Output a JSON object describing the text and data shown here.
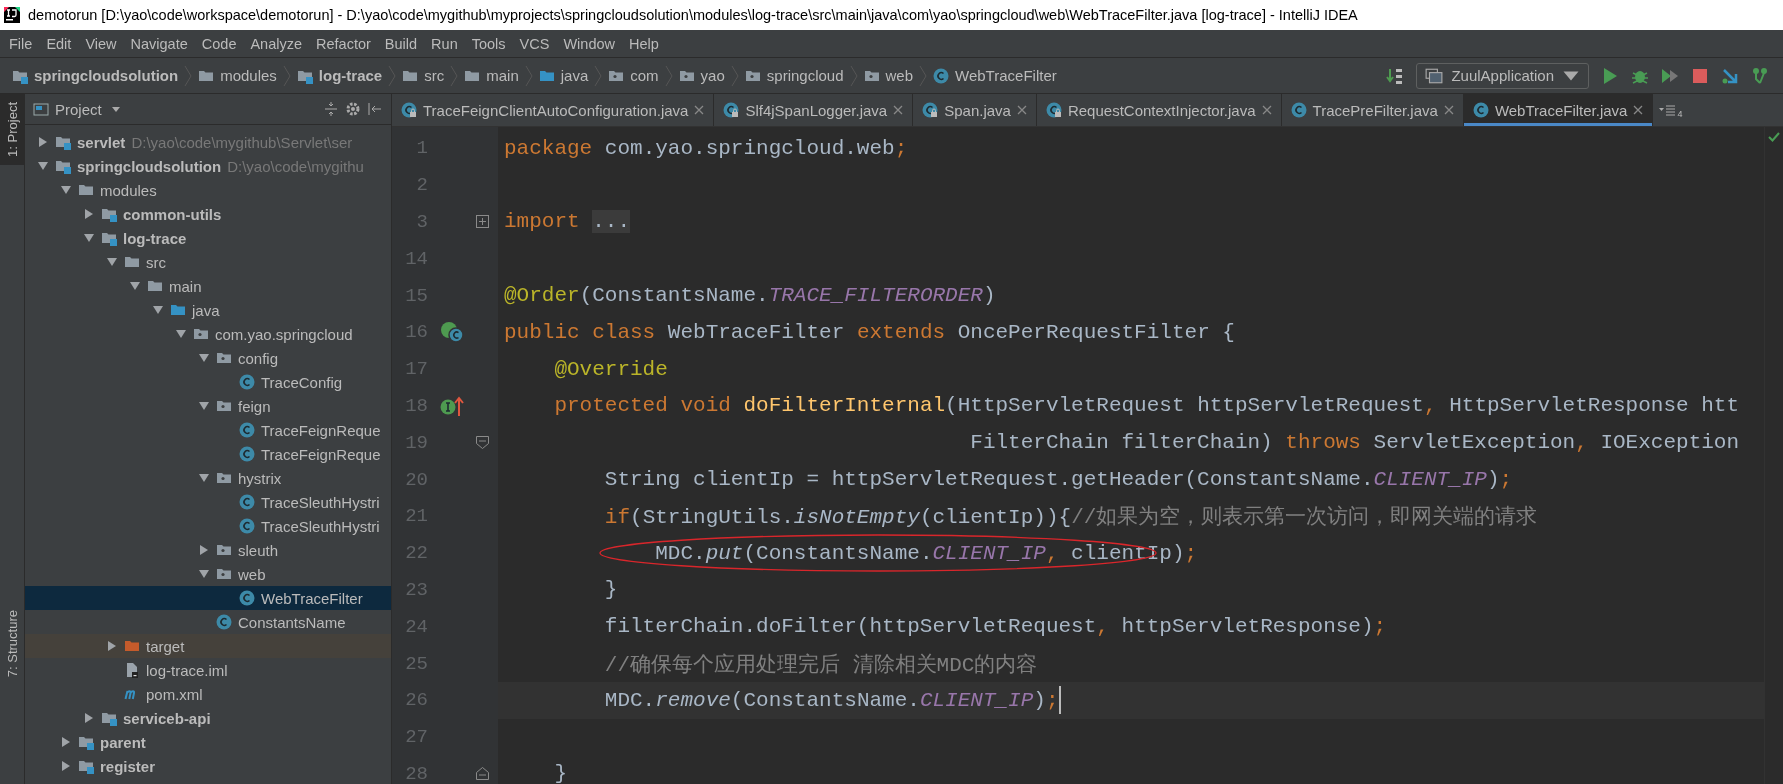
{
  "window": {
    "title": "demotorun [D:\\yao\\code\\workspace\\demotorun] - D:\\yao\\code\\mygithub\\myprojects\\springcloudsolution\\modules\\log-trace\\src\\main\\java\\com\\yao\\springcloud\\web\\WebTraceFilter.java [log-trace] - IntelliJ IDEA"
  },
  "menu": [
    "File",
    "Edit",
    "View",
    "Navigate",
    "Code",
    "Analyze",
    "Refactor",
    "Build",
    "Run",
    "Tools",
    "VCS",
    "Window",
    "Help"
  ],
  "breadcrumbs": [
    {
      "label": "springcloudsolution",
      "kind": "module"
    },
    {
      "label": "modules",
      "kind": "folder"
    },
    {
      "label": "log-trace",
      "kind": "module"
    },
    {
      "label": "src",
      "kind": "folder"
    },
    {
      "label": "main",
      "kind": "folder"
    },
    {
      "label": "java",
      "kind": "source"
    },
    {
      "label": "com",
      "kind": "package"
    },
    {
      "label": "yao",
      "kind": "package"
    },
    {
      "label": "springcloud",
      "kind": "package"
    },
    {
      "label": "web",
      "kind": "package"
    },
    {
      "label": "WebTraceFilter",
      "kind": "class"
    }
  ],
  "run_config": "ZuulApplication",
  "tool_windows": [
    {
      "label": "1: Project",
      "selected": true
    },
    {
      "label": "7: Structure",
      "selected": false
    }
  ],
  "project_panel": {
    "title": "Project",
    "tree": [
      {
        "label": "servlet",
        "hint": "D:\\yao\\code\\mygithub\\Servlet\\ser",
        "kind": "module",
        "expanded": false,
        "selected": false
      },
      {
        "label": "springcloudsolution",
        "hint": "D:\\yao\\code\\mygithu",
        "kind": "module",
        "expanded": true,
        "selected": false,
        "children": [
          {
            "label": "modules",
            "kind": "folder",
            "expanded": true,
            "selected": false,
            "children": [
              {
                "label": "common-utils",
                "kind": "module",
                "expanded": false,
                "selected": false
              },
              {
                "label": "log-trace",
                "kind": "module",
                "expanded": true,
                "selected": false,
                "children": [
                  {
                    "label": "src",
                    "kind": "folder",
                    "expanded": true,
                    "selected": false,
                    "children": [
                      {
                        "label": "main",
                        "kind": "folder",
                        "expanded": true,
                        "selected": false,
                        "children": [
                          {
                            "label": "java",
                            "kind": "source",
                            "expanded": true,
                            "selected": false,
                            "children": [
                              {
                                "label": "com.yao.springcloud",
                                "kind": "package",
                                "expanded": true,
                                "selected": false,
                                "children": [
                                  {
                                    "label": "config",
                                    "kind": "package",
                                    "expanded": true,
                                    "selected": false,
                                    "children": [
                                      {
                                        "label": "TraceConfig",
                                        "kind": "class",
                                        "selected": false
                                      }
                                    ]
                                  },
                                  {
                                    "label": "feign",
                                    "kind": "package",
                                    "expanded": true,
                                    "selected": false,
                                    "children": [
                                      {
                                        "label": "TraceFeignReque",
                                        "kind": "class",
                                        "selected": false
                                      },
                                      {
                                        "label": "TraceFeignReque",
                                        "kind": "class",
                                        "selected": false
                                      }
                                    ]
                                  },
                                  {
                                    "label": "hystrix",
                                    "kind": "package",
                                    "expanded": true,
                                    "selected": false,
                                    "children": [
                                      {
                                        "label": "TraceSleuthHystri",
                                        "kind": "class",
                                        "selected": false
                                      },
                                      {
                                        "label": "TraceSleuthHystri",
                                        "kind": "class",
                                        "selected": false
                                      }
                                    ]
                                  },
                                  {
                                    "label": "sleuth",
                                    "kind": "package",
                                    "expanded": false,
                                    "selected": false
                                  },
                                  {
                                    "label": "web",
                                    "kind": "package",
                                    "expanded": true,
                                    "selected": false,
                                    "children": [
                                      {
                                        "label": "WebTraceFilter",
                                        "kind": "class",
                                        "selected": true
                                      }
                                    ]
                                  },
                                  {
                                    "label": "ConstantsName",
                                    "kind": "class",
                                    "selected": false
                                  }
                                ]
                              }
                            ]
                          }
                        ]
                      }
                    ]
                  },
                  {
                    "label": "target",
                    "kind": "excluded",
                    "expanded": false,
                    "selected": false
                  },
                  {
                    "label": "log-trace.iml",
                    "kind": "iml",
                    "selected": false
                  },
                  {
                    "label": "pom.xml",
                    "kind": "maven",
                    "selected": false
                  }
                ]
              },
              {
                "label": "serviceb-api",
                "kind": "module",
                "expanded": false,
                "selected": false
              }
            ]
          },
          {
            "label": "parent",
            "kind": "module",
            "expanded": false,
            "selected": false
          },
          {
            "label": "register",
            "kind": "module",
            "expanded": false,
            "selected": false
          }
        ]
      }
    ]
  },
  "tabs": [
    {
      "label": "TraceFeignClientAutoConfiguration.java",
      "locked": true,
      "selected": false
    },
    {
      "label": "Slf4jSpanLogger.java",
      "locked": true,
      "selected": false
    },
    {
      "label": "Span.java",
      "locked": true,
      "selected": false
    },
    {
      "label": "RequestContextInjector.java",
      "locked": true,
      "selected": false
    },
    {
      "label": "TracePreFilter.java",
      "locked": false,
      "selected": false
    },
    {
      "label": "WebTraceFilter.java",
      "locked": false,
      "selected": true
    }
  ],
  "tab_overflow_count": "4",
  "editor": {
    "lines": [
      {
        "number": "1",
        "tokens": [
          {
            "kind": "kw",
            "text": "package"
          },
          {
            "kind": "plain",
            "text": " com.yao.springcloud.web"
          },
          {
            "kind": "kw",
            "text": ";"
          }
        ]
      },
      {
        "number": "2"
      },
      {
        "number": "3",
        "fold": {
          "kind": "collapsed"
        },
        "tokens": [
          {
            "kind": "kw",
            "text": "import "
          },
          {
            "kind": "folded",
            "text": "..."
          }
        ]
      },
      {
        "number": "14"
      },
      {
        "number": "15",
        "tokens": [
          {
            "kind": "ann",
            "text": "@Order"
          },
          {
            "kind": "plain",
            "text": "(ConstantsName."
          },
          {
            "kind": "const",
            "text": "TRACE_FILTERORDER"
          },
          {
            "kind": "plain",
            "text": ")"
          }
        ]
      },
      {
        "number": "16",
        "marker": {
          "kind": "subclassed"
        },
        "tokens": [
          {
            "kind": "kw",
            "text": "public class"
          },
          {
            "kind": "plain",
            "text": " WebTraceFilter "
          },
          {
            "kind": "kw",
            "text": "extends"
          },
          {
            "kind": "plain",
            "text": " OncePerRequestFilter {"
          }
        ]
      },
      {
        "number": "17",
        "tokens": [
          {
            "kind": "ann",
            "text": "    @Override"
          }
        ]
      },
      {
        "number": "18",
        "marker": {
          "kind": "overrides"
        },
        "tokens": [
          {
            "kind": "kw",
            "text": "    protected void "
          },
          {
            "kind": "decl",
            "text": "doFilterInternal"
          },
          {
            "kind": "plain",
            "text": "(HttpServletRequest httpServletRequest"
          },
          {
            "kind": "kw",
            "text": ","
          },
          {
            "kind": "plain",
            "text": " HttpServletResponse htt"
          }
        ]
      },
      {
        "number": "19",
        "fold": {
          "kind": "open"
        },
        "tokens": [
          {
            "kind": "plain",
            "text": "                                     FilterChain filterChain) "
          },
          {
            "kind": "kw",
            "text": "throws"
          },
          {
            "kind": "plain",
            "text": " ServletException"
          },
          {
            "kind": "kw",
            "text": ","
          },
          {
            "kind": "plain",
            "text": " IOException"
          }
        ]
      },
      {
        "number": "20",
        "tokens": [
          {
            "kind": "plain",
            "text": "        String clientIp = httpServletRequest.getHeader(ConstantsName."
          },
          {
            "kind": "const",
            "text": "CLIENT_IP"
          },
          {
            "kind": "plain",
            "text": ")"
          },
          {
            "kind": "kw",
            "text": ";"
          }
        ]
      },
      {
        "number": "21",
        "tokens": [
          {
            "kind": "kw",
            "text": "        if"
          },
          {
            "kind": "plain",
            "text": "(StringUtils."
          },
          {
            "kind": "static",
            "text": "isNotEmpty"
          },
          {
            "kind": "plain",
            "text": "(clientIp)){"
          },
          {
            "kind": "comment",
            "text": "//如果为空，则表示第一次访问，即网关端的请求"
          }
        ]
      },
      {
        "number": "22",
        "circled": true,
        "tokens": [
          {
            "kind": "plain",
            "text": "            MDC."
          },
          {
            "kind": "static",
            "text": "put"
          },
          {
            "kind": "plain",
            "text": "(ConstantsName."
          },
          {
            "kind": "const",
            "text": "CLIENT_IP"
          },
          {
            "kind": "kw",
            "text": ","
          },
          {
            "kind": "plain",
            "text": " clientIp)"
          },
          {
            "kind": "kw",
            "text": ";"
          }
        ]
      },
      {
        "number": "23",
        "tokens": [
          {
            "kind": "plain",
            "text": "        }"
          }
        ]
      },
      {
        "number": "24",
        "tokens": [
          {
            "kind": "plain",
            "text": "        filterChain.doFilter(httpServletRequest"
          },
          {
            "kind": "kw",
            "text": ","
          },
          {
            "kind": "plain",
            "text": " httpServletResponse)"
          },
          {
            "kind": "kw",
            "text": ";"
          }
        ]
      },
      {
        "number": "25",
        "tokens": [
          {
            "kind": "comment",
            "text": "        //确保每个应用处理完后 清除相关MDC的内容"
          }
        ]
      },
      {
        "number": "26",
        "current": true,
        "tokens": [
          {
            "kind": "plain",
            "text": "        MDC."
          },
          {
            "kind": "static",
            "text": "remove"
          },
          {
            "kind": "plain",
            "text": "(ConstantsName."
          },
          {
            "kind": "const",
            "text": "CLIENT_IP"
          },
          {
            "kind": "plain",
            "text": ")"
          },
          {
            "kind": "kw",
            "text": ";"
          }
        ]
      },
      {
        "number": "27"
      },
      {
        "number": "28",
        "fold": {
          "kind": "end"
        },
        "tokens": [
          {
            "kind": "plain",
            "text": "    }"
          }
        ]
      }
    ]
  }
}
